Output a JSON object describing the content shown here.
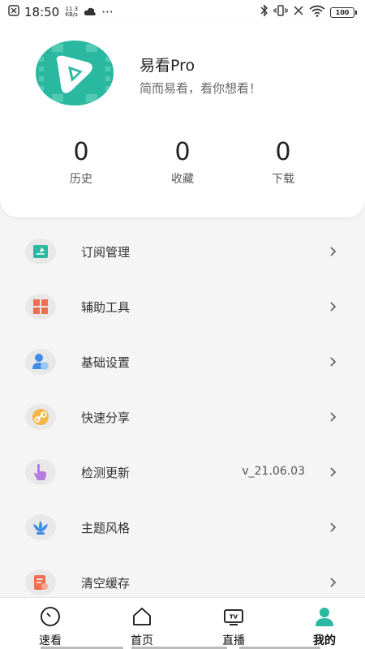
{
  "status_bar": {
    "time": "18:50",
    "net_speed_value": "11.3",
    "net_speed_unit": "KB/s",
    "more": "···",
    "battery": "100"
  },
  "profile": {
    "app_name": "易看Pro",
    "slogan": "简而易看，看你想看！",
    "stats": [
      {
        "count": "0",
        "label": "历史"
      },
      {
        "count": "0",
        "label": "收藏"
      },
      {
        "count": "0",
        "label": "下载"
      }
    ]
  },
  "menu": {
    "items": [
      {
        "label": "订阅管理",
        "icon": "subscription-icon",
        "value": ""
      },
      {
        "label": "辅助工具",
        "icon": "tools-grid-icon",
        "value": ""
      },
      {
        "label": "基础设置",
        "icon": "user-settings-icon",
        "value": ""
      },
      {
        "label": "快速分享",
        "icon": "link-icon",
        "value": ""
      },
      {
        "label": "检测更新",
        "icon": "hand-pointer-icon",
        "value": "v_21.06.03"
      },
      {
        "label": "主题风格",
        "icon": "lotus-icon",
        "value": ""
      },
      {
        "label": "清空缓存",
        "icon": "clear-cache-icon",
        "value": ""
      }
    ]
  },
  "bottom_nav": {
    "items": [
      {
        "label": "速看",
        "icon": "clock-icon"
      },
      {
        "label": "首页",
        "icon": "home-icon"
      },
      {
        "label": "直播",
        "icon": "tv-icon"
      },
      {
        "label": "我的",
        "icon": "person-icon",
        "active": true
      }
    ]
  },
  "colors": {
    "accent": "#2bb8a0",
    "background": "#f5f5f5"
  }
}
